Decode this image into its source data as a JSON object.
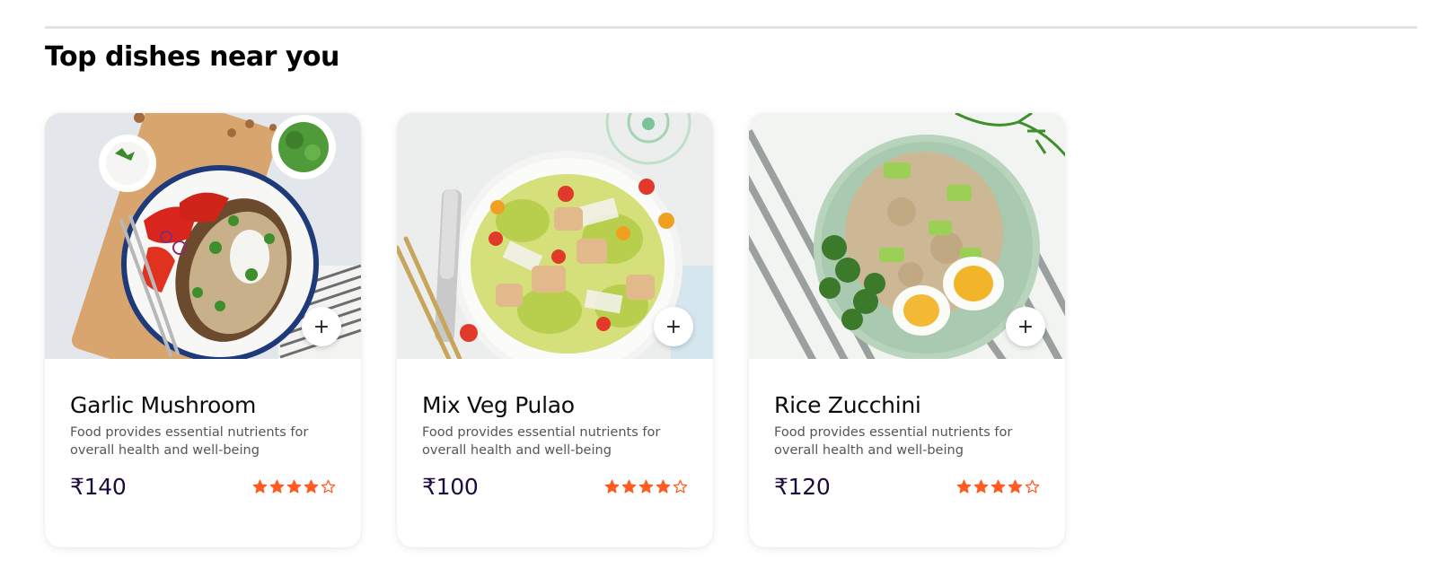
{
  "section": {
    "title": "Top dishes near you"
  },
  "colors": {
    "star": "#ff5b22",
    "price": "#1b0a3d",
    "divider": "#e3e3e3"
  },
  "dishes": [
    {
      "name": "Garlic Mushroom",
      "description": "Food provides essential nutrients for overall health and well-being",
      "price": "₹140",
      "rating": 4,
      "rating_max": 5,
      "add_icon": "plus-icon"
    },
    {
      "name": "Mix Veg Pulao",
      "description": "Food provides essential nutrients for overall health and well-being",
      "price": "₹100",
      "rating": 4,
      "rating_max": 5,
      "add_icon": "plus-icon"
    },
    {
      "name": "Rice Zucchini",
      "description": "Food provides essential nutrients for overall health and well-being",
      "price": "₹120",
      "rating": 4,
      "rating_max": 5,
      "add_icon": "plus-icon"
    }
  ]
}
